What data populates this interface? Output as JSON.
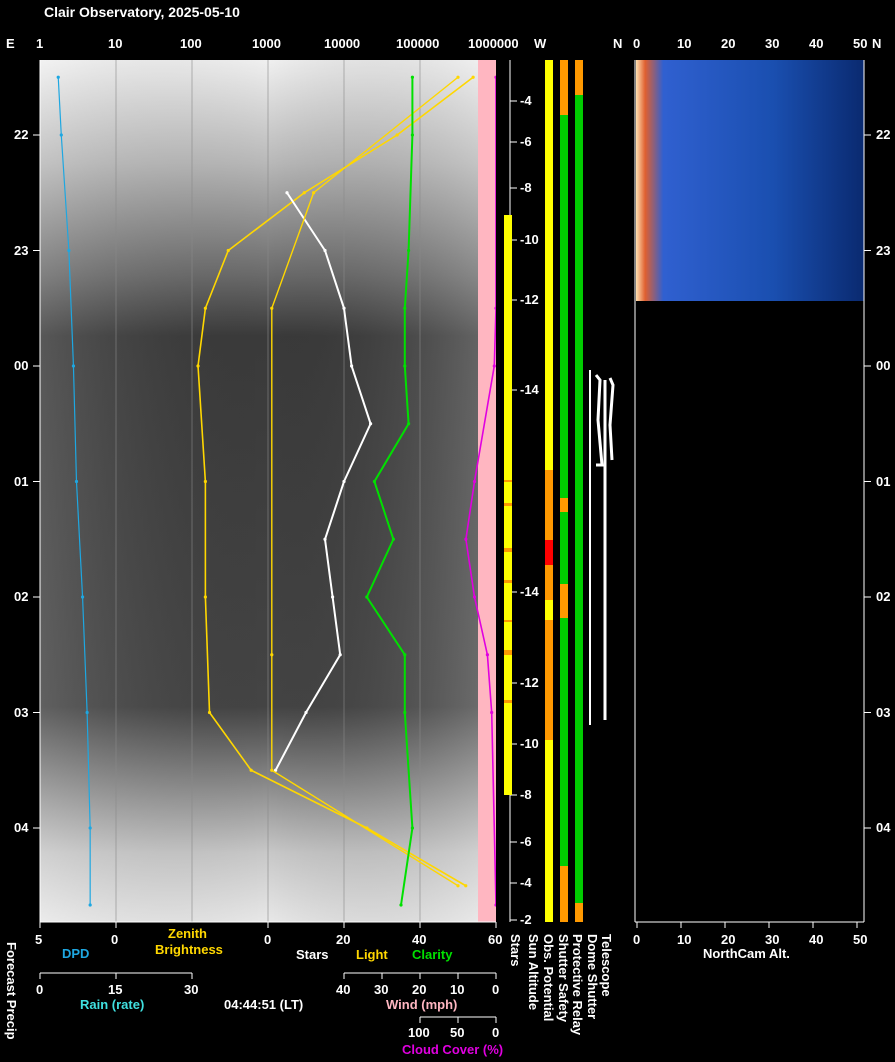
{
  "title": "Clair Observatory, 2025-05-10",
  "footer_time": "04:44:51 (LT)",
  "colors": {
    "background": "#000000",
    "axis": "#ffffff",
    "dpd": "#1ea7e1",
    "rain": "#40e0e0",
    "brightness": "#ffd700",
    "stars": "#ffffff",
    "light": "#ffd700",
    "clarity": "#00e000",
    "wind": "#ffb6c1",
    "cloud": "#e000e0",
    "sun_altitude": "#ffffff",
    "good": "#00cc00",
    "warn": "#ff9900",
    "bad": "#ff0000",
    "ok_yellow": "#ffff00"
  },
  "top_axis": {
    "left_compass": "E",
    "brightness_ticks": [
      "1",
      "10",
      "100",
      "1000",
      "10000",
      "100000",
      "1000000"
    ],
    "right_compass_w": "W",
    "right_compass_n": "N",
    "cam_ticks": [
      "0",
      "10",
      "20",
      "30",
      "40",
      "50"
    ],
    "cam_compass": "N"
  },
  "time_ticks": [
    "22",
    "23",
    "00",
    "01",
    "02",
    "03",
    "04"
  ],
  "sun_altitude_ticks": [
    "-4",
    "-6",
    "-8",
    "-10",
    "-12",
    "-14",
    "-14",
    "-12",
    "-10",
    "-8",
    "-6",
    "-4",
    "-2"
  ],
  "bottom": {
    "dpd_ticks": [
      "5",
      "0"
    ],
    "dpd_label": "DPD",
    "brightness_label_1": "Zenith",
    "brightness_label_2": "Brightness",
    "main_ticks": [
      "0",
      "20",
      "40",
      "60"
    ],
    "stars_label": "Stars",
    "light_label": "Light",
    "clarity_label": "Clarity",
    "rain_ticks": [
      "0",
      "15",
      "30"
    ],
    "rain_label": "Rain (rate)",
    "wind_ticks": [
      "40",
      "30",
      "20",
      "10",
      "0"
    ],
    "wind_label": "Wind (mph)",
    "cloud_ticks": [
      "100",
      "50",
      "0"
    ],
    "cloud_label": "Cloud Cover (%)",
    "forecast_label": "Forecast Precip",
    "cam_ticks": [
      "0",
      "10",
      "20",
      "30",
      "40",
      "50"
    ],
    "cam_label": "NorthCam Alt."
  },
  "status_columns": [
    "Stars",
    "Sun Altitude",
    "Obs. Potential",
    "Shutter Safety",
    "Protective Relay",
    "Dome Shutter",
    "Telescope"
  ],
  "chart_data": {
    "type": "line",
    "title": "Clair Observatory, 2025-05-10",
    "time_axis": {
      "labels": [
        "22",
        "23",
        "00",
        "01",
        "02",
        "03",
        "04"
      ]
    },
    "series": [
      {
        "name": "Zenith Brightness",
        "axis": "log 1–1000000",
        "x": [
          "21:30",
          "22:00",
          "22:30",
          "23:00",
          "23:30",
          "00:00",
          "01:00",
          "02:00",
          "03:00",
          "03:30",
          "04:00",
          "04:30"
        ],
        "values": [
          500000,
          50000,
          3000,
          300,
          150,
          120,
          150,
          150,
          170,
          600,
          20000,
          400000
        ]
      },
      {
        "name": "Stars",
        "axis": "0–60",
        "x": [
          "22:30",
          "23:00",
          "23:30",
          "00:00",
          "00:30",
          "01:00",
          "01:30",
          "02:00",
          "02:30",
          "03:00",
          "03:30"
        ],
        "values": [
          5,
          15,
          20,
          22,
          27,
          20,
          15,
          17,
          19,
          10,
          2
        ]
      },
      {
        "name": "Light",
        "axis": "0–60",
        "x": [
          "21:30",
          "22:30",
          "23:30",
          "02:30",
          "03:30",
          "04:30"
        ],
        "values": [
          50,
          12,
          1,
          1,
          1,
          50
        ]
      },
      {
        "name": "Clarity",
        "axis": "0–60",
        "x": [
          "21:30",
          "22:00",
          "23:00",
          "23:30",
          "00:00",
          "00:30",
          "01:00",
          "01:30",
          "02:00",
          "02:30",
          "03:00",
          "04:00",
          "04:40"
        ],
        "values": [
          38,
          38,
          37,
          36,
          36,
          37,
          28,
          33,
          26,
          36,
          36,
          38,
          35
        ]
      },
      {
        "name": "Cloud Cover (%)",
        "x": [
          "21:30",
          "23:30",
          "00:00",
          "01:00",
          "01:30",
          "02:00",
          "02:30",
          "03:00",
          "04:40"
        ],
        "values": [
          0,
          0,
          2,
          25,
          35,
          25,
          10,
          5,
          0
        ]
      },
      {
        "name": "DPD",
        "x": [
          "21:30",
          "22:00",
          "23:00",
          "00:00",
          "01:00",
          "02:00",
          "03:00",
          "04:00",
          "04:40"
        ],
        "values": [
          3.8,
          3.6,
          3.1,
          2.8,
          2.6,
          2.2,
          1.9,
          1.7,
          1.7
        ]
      }
    ]
  }
}
